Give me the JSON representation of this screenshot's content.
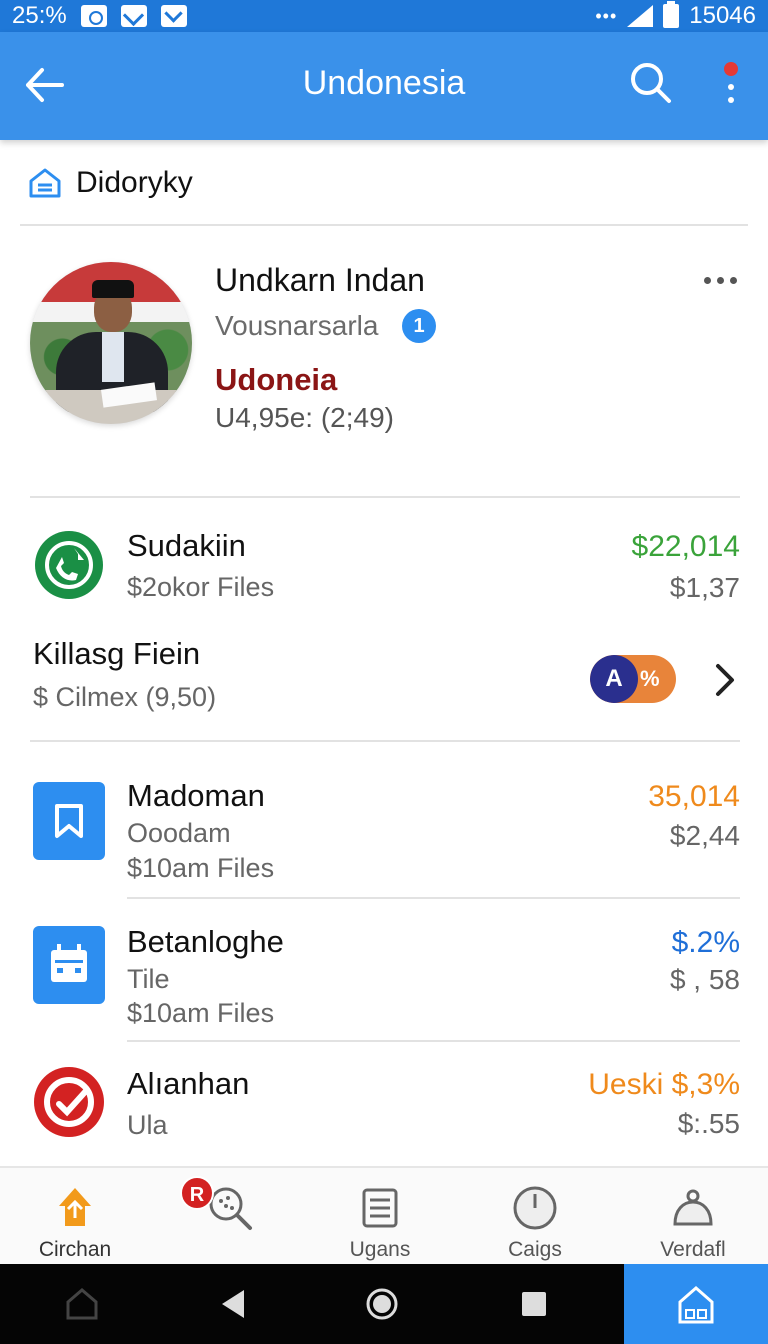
{
  "status_bar": {
    "left_text": "25:%",
    "right_text": "15046"
  },
  "app_bar": {
    "title": "Undonesia"
  },
  "breadcrumb": {
    "label": "Didoryky"
  },
  "profile": {
    "name": "Undkarn Indan",
    "subtitle": "Vousnarsarla",
    "badge_count": "1",
    "accent_label": "Udoneia",
    "meta": "U4,95e: (2;49)"
  },
  "summary_rows": [
    {
      "title": "Sudakiin",
      "subtitle": "$2okor Files",
      "value": "$22,014",
      "value_color": "#3aa33a",
      "secondary": "$1,37"
    },
    {
      "title": "Killasg Fiein",
      "subtitle": "$ Cilmex (9,50)",
      "pill_letter": "A",
      "pill_text": "%"
    }
  ],
  "list_rows": [
    {
      "title": "Madoman",
      "line2": "Ooodam",
      "line3": "$10am Files",
      "value": "35,014",
      "value_color": "#ef8a1c",
      "secondary": "$2,44"
    },
    {
      "title": "Betanloghe",
      "line2": "Tile",
      "line3": "$10am Files",
      "value": "$.2%",
      "value_color": "#1f6fd8",
      "secondary": "$ , 58"
    },
    {
      "title": "Alıanhan",
      "line2": "Ula",
      "value_prefix": "Ueski",
      "value": "$,3%",
      "value_color": "#ef8a1c",
      "secondary": "$:.55"
    }
  ],
  "bottom_nav": [
    {
      "label": "Circhan",
      "icon": "home-icon"
    },
    {
      "label": "",
      "icon": "search-dots-icon",
      "badge": "R"
    },
    {
      "label": "Ugans",
      "icon": "list-icon"
    },
    {
      "label": "Caigs",
      "icon": "clock-icon"
    },
    {
      "label": "Verdafl",
      "icon": "bell-icon"
    }
  ],
  "colors": {
    "primary": "#3a91ea",
    "status_bar": "#1f78d8",
    "accent_red": "#8b1515",
    "green": "#3aa33a",
    "orange": "#ef8a1c",
    "blue": "#1f6fd8"
  }
}
